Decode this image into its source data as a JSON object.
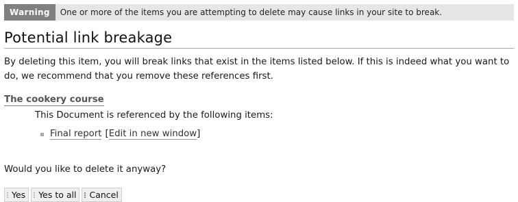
{
  "warning": {
    "tag": "Warning",
    "message": "One or more of the items you are attempting to delete may cause links in your site to break."
  },
  "heading": "Potential link breakage",
  "description": "By deleting this item, you will break links that exist in the items listed below. If this is indeed what you want to do, we recommend that you remove these references first.",
  "document": {
    "title": "The cookery course",
    "referenced_text": "This Document is referenced by the following items:",
    "references": [
      {
        "label": "Final report",
        "edit_prefix": "[",
        "edit_label": "Edit in new window",
        "edit_suffix": "]"
      }
    ]
  },
  "question": "Would you like to delete it anyway?",
  "buttons": {
    "yes": "Yes",
    "yes_to_all": "Yes to all",
    "cancel": "Cancel"
  },
  "colors": {
    "warning_tag_bg": "#808080",
    "warning_bar_bg": "#e6e6e6",
    "button_bg": "#efefef"
  }
}
